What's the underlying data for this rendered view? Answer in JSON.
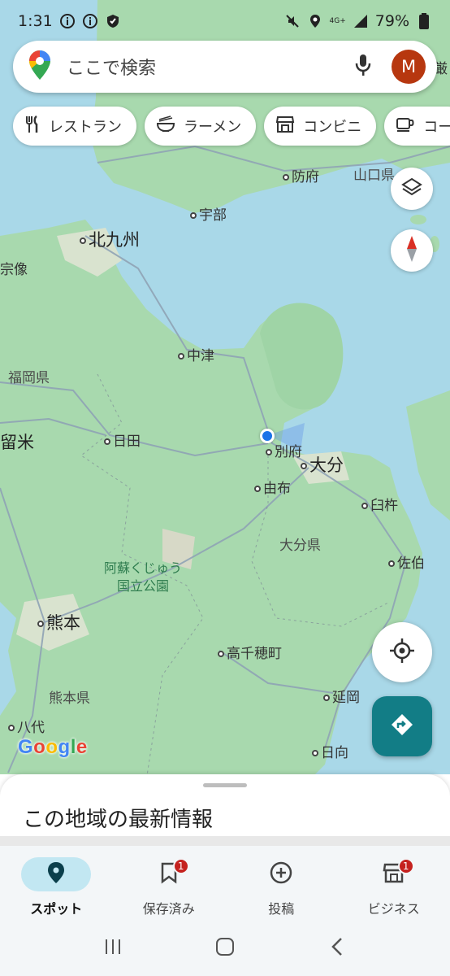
{
  "status_bar": {
    "time": "1:31",
    "battery": "79%",
    "network": "4G+"
  },
  "search": {
    "placeholder": "ここで検索",
    "avatar_letter": "M",
    "avatar_color": "#b7370f"
  },
  "chips": [
    {
      "label": "レストラン",
      "icon": "restaurant-icon"
    },
    {
      "label": "ラーメン",
      "icon": "ramen-icon"
    },
    {
      "label": "コンビニ",
      "icon": "store-icon"
    },
    {
      "label": "コー",
      "icon": "coffee-icon"
    }
  ],
  "map": {
    "labels": {
      "kitakyushu": "北九州",
      "hofu": "防府",
      "yamaguchi": "山口県",
      "ube": "宇部",
      "munakata": "宗像",
      "nakatsu": "中津",
      "fukuoka_pref": "福岡県",
      "kurume": "留米",
      "hita": "日田",
      "beppu": "別府",
      "oita": "大分",
      "yufu": "由布",
      "usuki": "臼杵",
      "oita_pref": "大分県",
      "saiki": "佐伯",
      "aso_park": "阿蘇くじゅう",
      "aso_park2": "国立公園",
      "kumamoto": "熊本",
      "takachiho": "高千穂町",
      "kumamoto_pref": "熊本県",
      "nobeoka": "延岡",
      "yatsushiro": "八代",
      "hyuga": "日向",
      "edge_top_right": "厳"
    },
    "water_color": "#a9d8e8",
    "land_color": "#a8d9ae"
  },
  "google_logo": "Google",
  "sheet": {
    "title": "この地域の最新情報"
  },
  "nav": [
    {
      "label": "スポット",
      "icon": "pin-icon",
      "active": true,
      "badge": ""
    },
    {
      "label": "保存済み",
      "icon": "bookmark-icon",
      "active": false,
      "badge": "1"
    },
    {
      "label": "投稿",
      "icon": "add-circle-icon",
      "active": false,
      "badge": ""
    },
    {
      "label": "ビジネス",
      "icon": "storefront-icon",
      "active": false,
      "badge": "1"
    }
  ],
  "accent": "#127d86"
}
